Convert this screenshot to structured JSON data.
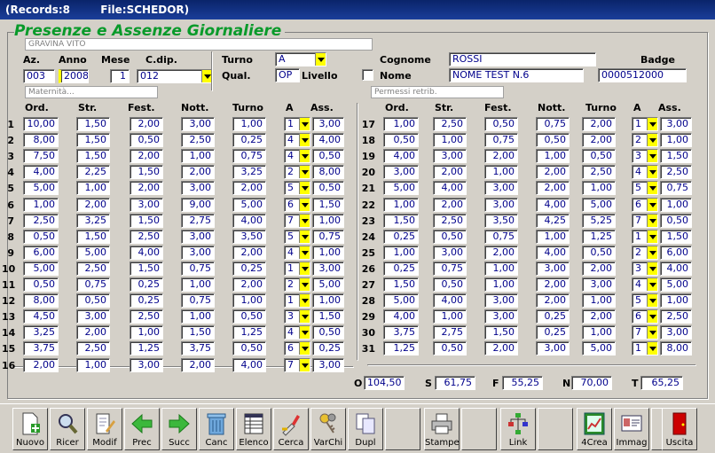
{
  "title": {
    "records": "(Records:8",
    "file": "File:SCHEDOR)"
  },
  "heading": "Presenze e Assenze Giornaliere",
  "employee_caption": "GRAVINA VITO",
  "fields": {
    "az_label": "Az.",
    "anno_label": "Anno",
    "mese_label": "Mese",
    "cdip_label": "C.dip.",
    "turno_label": "Turno",
    "qual_label": "Qual.",
    "livello_label": "Livello",
    "cognome_label": "Cognome",
    "nome_label": "Nome",
    "badge_label": "Badge",
    "az": "003",
    "anno": "2008",
    "mese": "1",
    "cdip": "012",
    "turno": "A",
    "qual": "OP",
    "cognome": "ROSSI",
    "nome": "NOME TEST N.6",
    "badge": "0000512000"
  },
  "captions": {
    "left": "Maternità...",
    "right": "Permessi retrib."
  },
  "columns": {
    "ord": "Ord.",
    "str": "Str.",
    "fest": "Fest.",
    "nott": "Nott.",
    "turno": "Turno",
    "a": "A",
    "ass": "Ass."
  },
  "rows_left": [
    {
      "n": "1",
      "ord": "10,00",
      "str": "1,50",
      "fest": "2,00",
      "nott": "3,00",
      "turno": "1,00",
      "a": "1",
      "ass": "3,00"
    },
    {
      "n": "2",
      "ord": "8,00",
      "str": "1,50",
      "fest": "0,50",
      "nott": "2,50",
      "turno": "0,25",
      "a": "4",
      "ass": "4,00"
    },
    {
      "n": "3",
      "ord": "7,50",
      "str": "1,50",
      "fest": "2,00",
      "nott": "1,00",
      "turno": "0,75",
      "a": "4",
      "ass": "0,50"
    },
    {
      "n": "4",
      "ord": "4,00",
      "str": "2,25",
      "fest": "1,50",
      "nott": "2,00",
      "turno": "3,25",
      "a": "2",
      "ass": "8,00"
    },
    {
      "n": "5",
      "ord": "5,00",
      "str": "1,00",
      "fest": "2,00",
      "nott": "3,00",
      "turno": "2,00",
      "a": "5",
      "ass": "0,50"
    },
    {
      "n": "6",
      "ord": "1,00",
      "str": "2,00",
      "fest": "3,00",
      "nott": "9,00",
      "turno": "5,00",
      "a": "6",
      "ass": "1,50"
    },
    {
      "n": "7",
      "ord": "2,50",
      "str": "3,25",
      "fest": "1,50",
      "nott": "2,75",
      "turno": "4,00",
      "a": "7",
      "ass": "1,00"
    },
    {
      "n": "8",
      "ord": "0,50",
      "str": "1,50",
      "fest": "2,50",
      "nott": "3,00",
      "turno": "3,50",
      "a": "5",
      "ass": "0,75"
    },
    {
      "n": "9",
      "ord": "6,00",
      "str": "5,00",
      "fest": "4,00",
      "nott": "3,00",
      "turno": "2,00",
      "a": "4",
      "ass": "1,00"
    },
    {
      "n": "10",
      "ord": "5,00",
      "str": "2,50",
      "fest": "1,50",
      "nott": "0,75",
      "turno": "0,25",
      "a": "1",
      "ass": "3,00"
    },
    {
      "n": "11",
      "ord": "0,50",
      "str": "0,75",
      "fest": "0,25",
      "nott": "1,00",
      "turno": "2,00",
      "a": "2",
      "ass": "5,00"
    },
    {
      "n": "12",
      "ord": "8,00",
      "str": "0,50",
      "fest": "0,25",
      "nott": "0,75",
      "turno": "1,00",
      "a": "1",
      "ass": "1,00"
    },
    {
      "n": "13",
      "ord": "4,50",
      "str": "3,00",
      "fest": "2,50",
      "nott": "1,00",
      "turno": "0,50",
      "a": "3",
      "ass": "1,50"
    },
    {
      "n": "14",
      "ord": "3,25",
      "str": "2,00",
      "fest": "1,00",
      "nott": "1,50",
      "turno": "1,25",
      "a": "4",
      "ass": "0,50"
    },
    {
      "n": "15",
      "ord": "3,75",
      "str": "2,50",
      "fest": "1,25",
      "nott": "3,75",
      "turno": "0,50",
      "a": "6",
      "ass": "0,25"
    },
    {
      "n": "16",
      "ord": "2,00",
      "str": "1,00",
      "fest": "3,00",
      "nott": "2,00",
      "turno": "4,00",
      "a": "7",
      "ass": "3,00"
    }
  ],
  "rows_right": [
    {
      "n": "17",
      "ord": "1,00",
      "str": "2,50",
      "fest": "0,50",
      "nott": "0,75",
      "turno": "2,00",
      "a": "1",
      "ass": "3,00"
    },
    {
      "n": "18",
      "ord": "0,50",
      "str": "1,00",
      "fest": "0,75",
      "nott": "0,50",
      "turno": "2,00",
      "a": "2",
      "ass": "1,00"
    },
    {
      "n": "19",
      "ord": "4,00",
      "str": "3,00",
      "fest": "2,00",
      "nott": "1,00",
      "turno": "0,50",
      "a": "3",
      "ass": "1,50"
    },
    {
      "n": "20",
      "ord": "3,00",
      "str": "2,00",
      "fest": "1,00",
      "nott": "2,00",
      "turno": "2,50",
      "a": "4",
      "ass": "2,50"
    },
    {
      "n": "21",
      "ord": "5,00",
      "str": "4,00",
      "fest": "3,00",
      "nott": "2,00",
      "turno": "1,00",
      "a": "5",
      "ass": "0,75"
    },
    {
      "n": "22",
      "ord": "1,00",
      "str": "2,00",
      "fest": "3,00",
      "nott": "4,00",
      "turno": "5,00",
      "a": "6",
      "ass": "1,00"
    },
    {
      "n": "23",
      "ord": "1,50",
      "str": "2,50",
      "fest": "3,50",
      "nott": "4,25",
      "turno": "5,25",
      "a": "7",
      "ass": "0,50"
    },
    {
      "n": "24",
      "ord": "0,25",
      "str": "0,50",
      "fest": "0,75",
      "nott": "1,00",
      "turno": "1,25",
      "a": "1",
      "ass": "1,50"
    },
    {
      "n": "25",
      "ord": "1,00",
      "str": "3,00",
      "fest": "2,00",
      "nott": "4,00",
      "turno": "0,50",
      "a": "2",
      "ass": "6,00"
    },
    {
      "n": "26",
      "ord": "0,25",
      "str": "0,75",
      "fest": "1,00",
      "nott": "3,00",
      "turno": "2,00",
      "a": "3",
      "ass": "4,00"
    },
    {
      "n": "27",
      "ord": "1,50",
      "str": "0,50",
      "fest": "1,00",
      "nott": "2,00",
      "turno": "3,00",
      "a": "4",
      "ass": "5,00"
    },
    {
      "n": "28",
      "ord": "5,00",
      "str": "4,00",
      "fest": "3,00",
      "nott": "2,00",
      "turno": "1,00",
      "a": "5",
      "ass": "1,00"
    },
    {
      "n": "29",
      "ord": "4,00",
      "str": "1,00",
      "fest": "3,00",
      "nott": "0,25",
      "turno": "2,00",
      "a": "6",
      "ass": "2,50"
    },
    {
      "n": "30",
      "ord": "3,75",
      "str": "2,75",
      "fest": "1,50",
      "nott": "0,25",
      "turno": "1,00",
      "a": "7",
      "ass": "3,00"
    },
    {
      "n": "31",
      "ord": "1,25",
      "str": "0,50",
      "fest": "2,00",
      "nott": "3,00",
      "turno": "5,00",
      "a": "1",
      "ass": "8,00"
    }
  ],
  "totals": {
    "o_label": "O",
    "o": "104,50",
    "s_label": "S",
    "s": "61,75",
    "f_label": "F",
    "f": "55,25",
    "n_label": "N",
    "n": "70,00",
    "t_label": "T",
    "t": "65,25"
  },
  "toolbar": [
    {
      "name": "nuovo",
      "label": "Nuovo",
      "icon": "new-document-icon"
    },
    {
      "name": "ricer",
      "label": "Ricer",
      "icon": "magnifier-icon"
    },
    {
      "name": "modif",
      "label": "Modif",
      "icon": "edit-document-icon"
    },
    {
      "name": "prec",
      "label": "Prec",
      "icon": "arrow-left-icon"
    },
    {
      "name": "succ",
      "label": "Succ",
      "icon": "arrow-right-icon"
    },
    {
      "name": "canc",
      "label": "Canc",
      "icon": "trash-icon"
    },
    {
      "name": "elenco",
      "label": "Elenco",
      "icon": "list-icon"
    },
    {
      "name": "cerca",
      "label": "Cerca",
      "icon": "brush-search-icon"
    },
    {
      "name": "varchi",
      "label": "VarChi",
      "icon": "keys-icon"
    },
    {
      "name": "dupl",
      "label": "Dupl",
      "icon": "duplicate-icon"
    },
    {
      "name": "blank1",
      "label": "",
      "icon": ""
    },
    {
      "name": "stampe",
      "label": "Stampe",
      "icon": "printer-icon"
    },
    {
      "name": "blank2",
      "label": "",
      "icon": ""
    },
    {
      "name": "link",
      "label": "Link",
      "icon": "network-icon"
    },
    {
      "name": "blank3",
      "label": "",
      "icon": ""
    },
    {
      "name": "4crea",
      "label": "4Crea",
      "icon": "chart-icon"
    },
    {
      "name": "immag",
      "label": "Immag",
      "icon": "id-card-icon"
    },
    {
      "name": "blank4",
      "label": "",
      "icon": ""
    },
    {
      "name": "uscita",
      "label": "Uscita",
      "icon": "exit-door-icon"
    }
  ],
  "colors": {
    "accent": "#089a2a",
    "combo": "#ffff00",
    "title": "#0a246a"
  }
}
